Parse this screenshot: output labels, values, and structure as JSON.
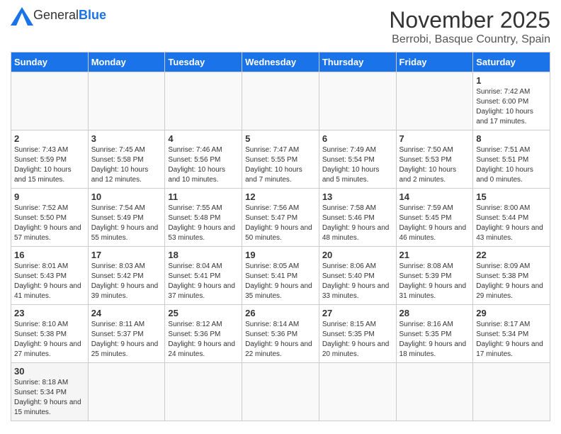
{
  "header": {
    "logo_general": "General",
    "logo_blue": "Blue",
    "title": "November 2025",
    "subtitle": "Berrobi, Basque Country, Spain"
  },
  "days_of_week": [
    "Sunday",
    "Monday",
    "Tuesday",
    "Wednesday",
    "Thursday",
    "Friday",
    "Saturday"
  ],
  "weeks": [
    [
      {
        "day": "",
        "info": ""
      },
      {
        "day": "",
        "info": ""
      },
      {
        "day": "",
        "info": ""
      },
      {
        "day": "",
        "info": ""
      },
      {
        "day": "",
        "info": ""
      },
      {
        "day": "",
        "info": ""
      },
      {
        "day": "1",
        "info": "Sunrise: 7:42 AM\nSunset: 6:00 PM\nDaylight: 10 hours and 17 minutes."
      }
    ],
    [
      {
        "day": "2",
        "info": "Sunrise: 7:43 AM\nSunset: 5:59 PM\nDaylight: 10 hours and 15 minutes."
      },
      {
        "day": "3",
        "info": "Sunrise: 7:45 AM\nSunset: 5:58 PM\nDaylight: 10 hours and 12 minutes."
      },
      {
        "day": "4",
        "info": "Sunrise: 7:46 AM\nSunset: 5:56 PM\nDaylight: 10 hours and 10 minutes."
      },
      {
        "day": "5",
        "info": "Sunrise: 7:47 AM\nSunset: 5:55 PM\nDaylight: 10 hours and 7 minutes."
      },
      {
        "day": "6",
        "info": "Sunrise: 7:49 AM\nSunset: 5:54 PM\nDaylight: 10 hours and 5 minutes."
      },
      {
        "day": "7",
        "info": "Sunrise: 7:50 AM\nSunset: 5:53 PM\nDaylight: 10 hours and 2 minutes."
      },
      {
        "day": "8",
        "info": "Sunrise: 7:51 AM\nSunset: 5:51 PM\nDaylight: 10 hours and 0 minutes."
      }
    ],
    [
      {
        "day": "9",
        "info": "Sunrise: 7:52 AM\nSunset: 5:50 PM\nDaylight: 9 hours and 57 minutes."
      },
      {
        "day": "10",
        "info": "Sunrise: 7:54 AM\nSunset: 5:49 PM\nDaylight: 9 hours and 55 minutes."
      },
      {
        "day": "11",
        "info": "Sunrise: 7:55 AM\nSunset: 5:48 PM\nDaylight: 9 hours and 53 minutes."
      },
      {
        "day": "12",
        "info": "Sunrise: 7:56 AM\nSunset: 5:47 PM\nDaylight: 9 hours and 50 minutes."
      },
      {
        "day": "13",
        "info": "Sunrise: 7:58 AM\nSunset: 5:46 PM\nDaylight: 9 hours and 48 minutes."
      },
      {
        "day": "14",
        "info": "Sunrise: 7:59 AM\nSunset: 5:45 PM\nDaylight: 9 hours and 46 minutes."
      },
      {
        "day": "15",
        "info": "Sunrise: 8:00 AM\nSunset: 5:44 PM\nDaylight: 9 hours and 43 minutes."
      }
    ],
    [
      {
        "day": "16",
        "info": "Sunrise: 8:01 AM\nSunset: 5:43 PM\nDaylight: 9 hours and 41 minutes."
      },
      {
        "day": "17",
        "info": "Sunrise: 8:03 AM\nSunset: 5:42 PM\nDaylight: 9 hours and 39 minutes."
      },
      {
        "day": "18",
        "info": "Sunrise: 8:04 AM\nSunset: 5:41 PM\nDaylight: 9 hours and 37 minutes."
      },
      {
        "day": "19",
        "info": "Sunrise: 8:05 AM\nSunset: 5:41 PM\nDaylight: 9 hours and 35 minutes."
      },
      {
        "day": "20",
        "info": "Sunrise: 8:06 AM\nSunset: 5:40 PM\nDaylight: 9 hours and 33 minutes."
      },
      {
        "day": "21",
        "info": "Sunrise: 8:08 AM\nSunset: 5:39 PM\nDaylight: 9 hours and 31 minutes."
      },
      {
        "day": "22",
        "info": "Sunrise: 8:09 AM\nSunset: 5:38 PM\nDaylight: 9 hours and 29 minutes."
      }
    ],
    [
      {
        "day": "23",
        "info": "Sunrise: 8:10 AM\nSunset: 5:38 PM\nDaylight: 9 hours and 27 minutes."
      },
      {
        "day": "24",
        "info": "Sunrise: 8:11 AM\nSunset: 5:37 PM\nDaylight: 9 hours and 25 minutes."
      },
      {
        "day": "25",
        "info": "Sunrise: 8:12 AM\nSunset: 5:36 PM\nDaylight: 9 hours and 24 minutes."
      },
      {
        "day": "26",
        "info": "Sunrise: 8:14 AM\nSunset: 5:36 PM\nDaylight: 9 hours and 22 minutes."
      },
      {
        "day": "27",
        "info": "Sunrise: 8:15 AM\nSunset: 5:35 PM\nDaylight: 9 hours and 20 minutes."
      },
      {
        "day": "28",
        "info": "Sunrise: 8:16 AM\nSunset: 5:35 PM\nDaylight: 9 hours and 18 minutes."
      },
      {
        "day": "29",
        "info": "Sunrise: 8:17 AM\nSunset: 5:34 PM\nDaylight: 9 hours and 17 minutes."
      }
    ],
    [
      {
        "day": "30",
        "info": "Sunrise: 8:18 AM\nSunset: 5:34 PM\nDaylight: 9 hours and 15 minutes."
      },
      {
        "day": "",
        "info": ""
      },
      {
        "day": "",
        "info": ""
      },
      {
        "day": "",
        "info": ""
      },
      {
        "day": "",
        "info": ""
      },
      {
        "day": "",
        "info": ""
      },
      {
        "day": "",
        "info": ""
      }
    ]
  ]
}
